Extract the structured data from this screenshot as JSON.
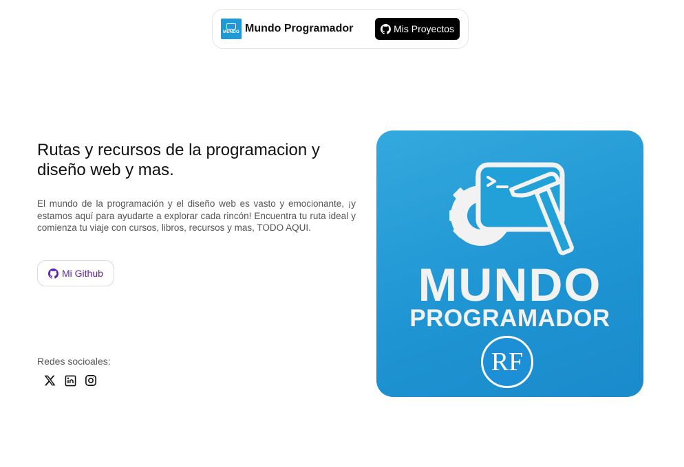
{
  "navbar": {
    "brand": "Mundo Programador",
    "logo_text": "MUNDO",
    "projects_button": "Mis Proyectos"
  },
  "hero": {
    "title": "Rutas y recursos de la programacion y diseño web y mas.",
    "description": "El mundo de la programación y el diseño web es vasto y emocionante, ¡y estamos aquí para ayudarte a explorar cada rincón! Encuentra tu ruta ideal y comienza tu viaje con cursos, libros, recursos y mas, TODO AQUI.",
    "github_button": "Mi Github"
  },
  "social": {
    "label": "Redes socioales:",
    "icons": [
      "x-icon",
      "linkedin-icon",
      "instagram-icon"
    ]
  },
  "image": {
    "word1": "MUNDO",
    "word2": "PROGRAMADOR",
    "badge": "RF"
  },
  "colors": {
    "accent_purple": "#5b21b6",
    "image_blue": "#1f95d3",
    "button_black": "#000000"
  }
}
